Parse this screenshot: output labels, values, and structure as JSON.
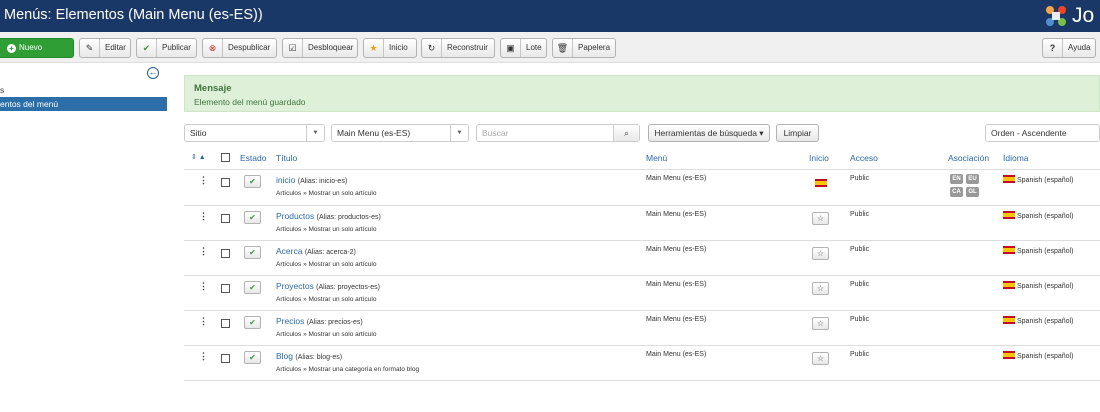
{
  "header": {
    "title": "Menús: Elementos (Main Menu (es-ES))",
    "logo_text": "Jo"
  },
  "toolbar": {
    "new_label": "Nuevo",
    "edit_label": "Editar",
    "publish_label": "Publicar",
    "unpublish_label": "Despublicar",
    "checkin_label": "Desbloquear",
    "home_label": "Inicio",
    "rebuild_label": "Reconstruir",
    "batch_label": "Lote",
    "trash_label": "Papelera",
    "help_label": "Ayuda"
  },
  "sidebar": {
    "items": [
      {
        "label": "s"
      },
      {
        "label": "entos del menú"
      }
    ]
  },
  "message": {
    "heading": "Mensaje",
    "text": "Elemento del menú guardado"
  },
  "filters": {
    "site": "Sitio",
    "menu": "Main Menu (es-ES)",
    "search_placeholder": "Buscar",
    "search_tools": "Herramientas de búsqueda ▾",
    "clear": "Limpiar",
    "order": "Orden - Ascendente"
  },
  "table": {
    "headers": {
      "sort": "⇕ ▲",
      "status": "Estado",
      "title": "Título",
      "menu": "Menú",
      "home": "Inicio",
      "access": "Acceso",
      "association": "Asociación",
      "language": "Idioma"
    },
    "rows": [
      {
        "name": "inicio",
        "alias": "(Alias: inicio-es)",
        "type": "Artículos » Mostrar un solo artículo",
        "menu": "Main Menu (es-ES)",
        "access": "Public",
        "language": "Spanish (español)",
        "is_home": true,
        "associations": [
          "EN",
          "EU",
          "CA",
          "GL"
        ]
      },
      {
        "name": "Productos",
        "alias": "(Alias: productos-es)",
        "type": "Artículos » Mostrar un solo artículo",
        "menu": "Main Menu (es-ES)",
        "access": "Public",
        "language": "Spanish (español)",
        "is_home": false,
        "associations": []
      },
      {
        "name": "Acerca",
        "alias": "(Alias: acerca-2)",
        "type": "Artículos » Mostrar un solo artículo",
        "menu": "Main Menu (es-ES)",
        "access": "Public",
        "language": "Spanish (español)",
        "is_home": false,
        "associations": []
      },
      {
        "name": "Proyectos",
        "alias": "(Alias: proyectos-es)",
        "type": "Artículos » Mostrar un solo artículo",
        "menu": "Main Menu (es-ES)",
        "access": "Public",
        "language": "Spanish (español)",
        "is_home": false,
        "associations": []
      },
      {
        "name": "Precios",
        "alias": "(Alias: precios-es)",
        "type": "Artículos » Mostrar un solo artículo",
        "menu": "Main Menu (es-ES)",
        "access": "Public",
        "language": "Spanish (español)",
        "is_home": false,
        "associations": []
      },
      {
        "name": "Blog",
        "alias": "(Alias: blog-es)",
        "type": "Artículos » Mostrar una categoría en formato blog",
        "menu": "Main Menu (es-ES)",
        "access": "Public",
        "language": "Spanish (español)",
        "is_home": false,
        "associations": []
      }
    ]
  }
}
